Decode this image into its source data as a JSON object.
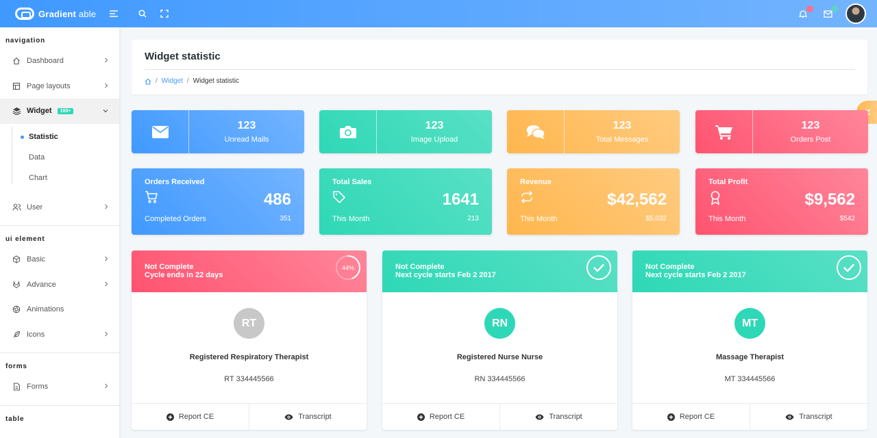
{
  "header": {
    "logo_bold": "Gradient",
    "logo_light": " able"
  },
  "sidebar": {
    "sections": {
      "navigation": "navigation",
      "ui_element": "ui element",
      "forms": "forms",
      "table": "table"
    },
    "items": {
      "dashboard": "Dashboard",
      "page_layouts": "Page layouts",
      "widget": "Widget",
      "widget_badge": "100+",
      "user": "User",
      "basic": "Basic",
      "advance": "Advance",
      "animations": "Animations",
      "icons": "Icons",
      "forms": "Forms"
    },
    "widget_sub": {
      "statistic": "Statistic",
      "data": "Data",
      "chart": "Chart"
    }
  },
  "page": {
    "title": "Widget statistic",
    "breadcrumb_link": "Widget",
    "breadcrumb_current": "Widget statistic"
  },
  "tiles": [
    {
      "value": "123",
      "label": "Unread Mails",
      "icon": "envelope-icon"
    },
    {
      "value": "123",
      "label": "Image Upload",
      "icon": "camera-icon"
    },
    {
      "value": "123",
      "label": "Total Messages",
      "icon": "comments-icon"
    },
    {
      "value": "123",
      "label": "Orders Post",
      "icon": "cart-icon"
    }
  ],
  "orders": [
    {
      "title": "Orders Received",
      "big": "486",
      "foot": "Completed Orders",
      "foot_val": "351",
      "icon": "cart-icon"
    },
    {
      "title": "Total Sales",
      "big": "1641",
      "foot": "This Month",
      "foot_val": "213",
      "icon": "tag-icon"
    },
    {
      "title": "Revenue",
      "big": "$42,562",
      "foot": "This Month",
      "foot_val": "$5,032",
      "icon": "repeat-icon"
    },
    {
      "title": "Total Profit",
      "big": "$9,562",
      "foot": "This Month",
      "foot_val": "$542",
      "icon": "award-icon"
    }
  ],
  "profiles": [
    {
      "line1": "Not Complete",
      "line2": "Cycle ends in 22 days",
      "progress_text": "44%",
      "progress": 0.44,
      "initials": "RT",
      "name": "Registered Respiratory Therapist",
      "code": "RT 334445566"
    },
    {
      "line1": "Not Complete",
      "line2": "Next cycle starts Feb 2 2017",
      "initials": "RN",
      "name": "Registered Nurse Nurse",
      "code": "RN 334445566"
    },
    {
      "line1": "Not Complete",
      "line2": "Next cycle starts Feb 2 2017",
      "initials": "MT",
      "name": "Massage Therapist",
      "code": "MT 334445566"
    }
  ],
  "profile_actions": {
    "report": "Report CE",
    "transcript": "Transcript"
  },
  "colors": {
    "blue": "#4099ff",
    "green": "#2ed8b6",
    "yellow": "#ffb64d",
    "pink": "#ff5370",
    "avatar_grey": "#c8c8c8"
  }
}
